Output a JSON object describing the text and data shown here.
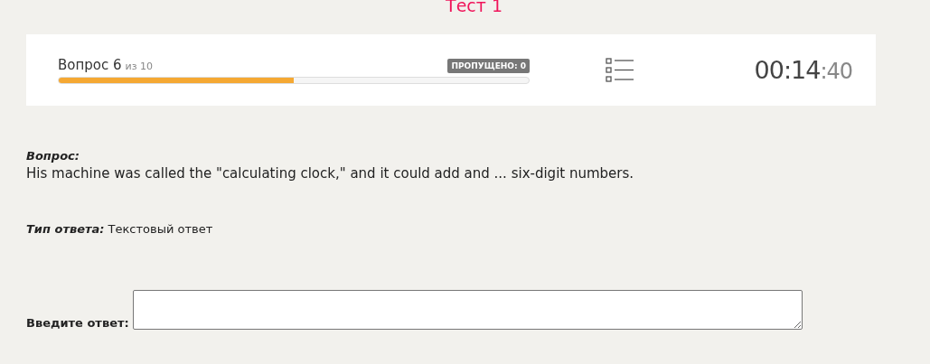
{
  "title": "Тест 1",
  "progress": {
    "question_label": "Вопрос 6",
    "question_total": "из 10",
    "skipped_badge": "ПРОПУЩЕНО: 0",
    "level": 0.5
  },
  "timer": {
    "main": "00:14",
    "seconds": ":40"
  },
  "question": {
    "label": "Вопрос:",
    "text": "His machine was called the \"calculating clock,\" and it could add and ... six-digit numbers."
  },
  "answer_type": {
    "label": "Тип ответа:",
    "value": "Текстовый ответ"
  },
  "answer": {
    "label": "Введите ответ:"
  }
}
